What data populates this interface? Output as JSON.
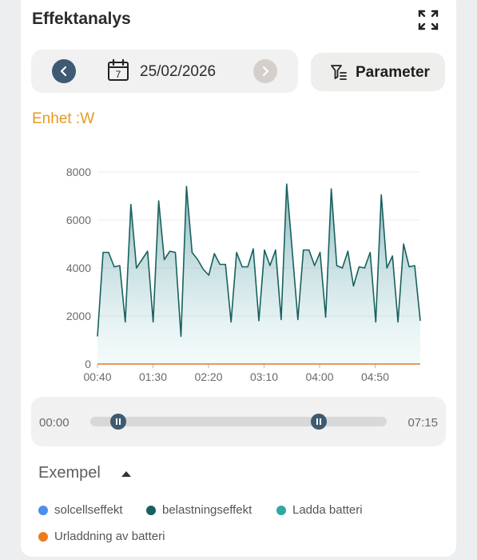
{
  "header": {
    "title": "Effektanalys",
    "expand_icon": "fullscreen-icon"
  },
  "date_nav": {
    "date": "25/02/2026",
    "prev_icon": "chevron-left-icon",
    "next_icon": "chevron-right-icon",
    "calendar_icon": "calendar-icon",
    "calendar_day": "7"
  },
  "parameter_button": {
    "label": "Parameter",
    "icon": "filter-icon"
  },
  "unit_label": "Enhet :W",
  "colors": {
    "accent": "#e79a1e",
    "series_line": "#17615f",
    "series_fill": "#8ec3c6",
    "baseline": "#e6762a",
    "nav_active": "#3f5a73",
    "nav_disabled": "#d4cfca"
  },
  "chart_data": {
    "type": "area",
    "y_ticks": [
      "8000",
      "6000",
      "4000",
      "2000",
      "0"
    ],
    "x_ticks": [
      "00:40",
      "01:30",
      "02:20",
      "03:10",
      "04:00",
      "04:50"
    ],
    "ylim": [
      0,
      8000
    ],
    "grid": true,
    "series": [
      {
        "name": "belastningseffekt",
        "x_range": [
          "00:40",
          "05:30"
        ],
        "values": [
          1150,
          4650,
          4650,
          4050,
          4100,
          1750,
          6650,
          4000,
          4350,
          4700,
          1750,
          6800,
          4350,
          4700,
          4650,
          1150,
          7400,
          4650,
          4350,
          3950,
          3700,
          4600,
          4150,
          4150,
          1750,
          4650,
          4050,
          4050,
          4800,
          1800,
          4750,
          4100,
          4750,
          1850,
          7500,
          4700,
          1850,
          4750,
          4750,
          4100,
          4650,
          1950,
          7300,
          4100,
          4000,
          4700,
          3250,
          4050,
          4000,
          4650,
          1750,
          7050,
          4000,
          4500,
          1750,
          5000,
          4050,
          4100,
          1800
        ]
      },
      {
        "name": "Urladdning av batteri",
        "values": [
          0,
          0
        ]
      }
    ]
  },
  "slider": {
    "min_label": "00:00",
    "max_label": "07:15",
    "start_fraction": 0.093,
    "end_fraction": 0.77
  },
  "legend": {
    "title": "Exempel",
    "toggle_icon": "caret-up-icon",
    "items": [
      {
        "label": "solcellseffekt",
        "color": "#4c8fe8"
      },
      {
        "label": "belastningseffekt",
        "color": "#17615f"
      },
      {
        "label": "Ladda batteri",
        "color": "#2fa7a3"
      },
      {
        "label": "Urladdning av batteri",
        "color": "#ef7b1d"
      }
    ]
  }
}
